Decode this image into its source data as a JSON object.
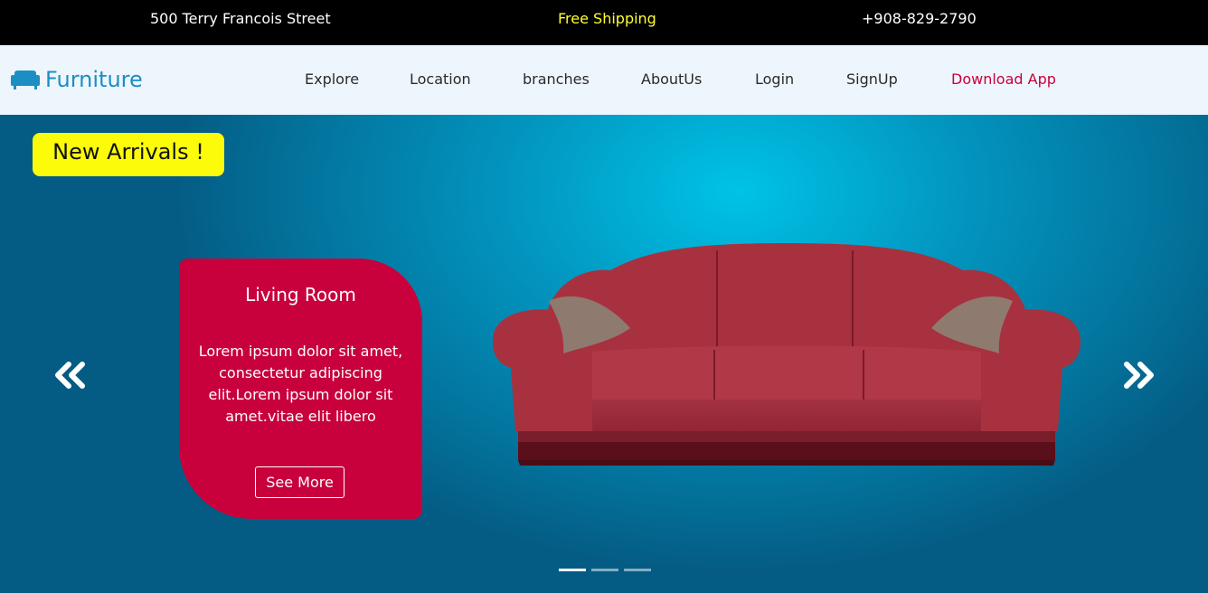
{
  "topbar": {
    "address": "500 Terry Francois Street",
    "promo": "Free Shipping",
    "phone": "+908-829-2790"
  },
  "navbar": {
    "brand": "Furniture",
    "brand_icon": "sofa-icon",
    "links": [
      "Explore",
      "Location",
      "branches",
      "AboutUs",
      "Login",
      "SignUp"
    ],
    "cta": "Download App"
  },
  "hero": {
    "badge": "New Arrivals !",
    "card": {
      "title": "Living Room",
      "description": "Lorem ipsum dolor sit amet, consectetur adipiscing elit.Lorem ipsum dolor sit amet.vitae elit libero",
      "button": "See More"
    },
    "prev_icon": "double-chevron-left-icon",
    "next_icon": "double-chevron-right-icon",
    "slide_count": 3,
    "active_slide": 1
  },
  "colors": {
    "topbar_bg": "#000000",
    "promo": "#ffff33",
    "brand": "#1b8fc4",
    "navbar_bg": "#eef6fd",
    "accent": "#c8003c",
    "badge_bg": "#fbfb0a",
    "hero_blue": "#0296c0"
  }
}
